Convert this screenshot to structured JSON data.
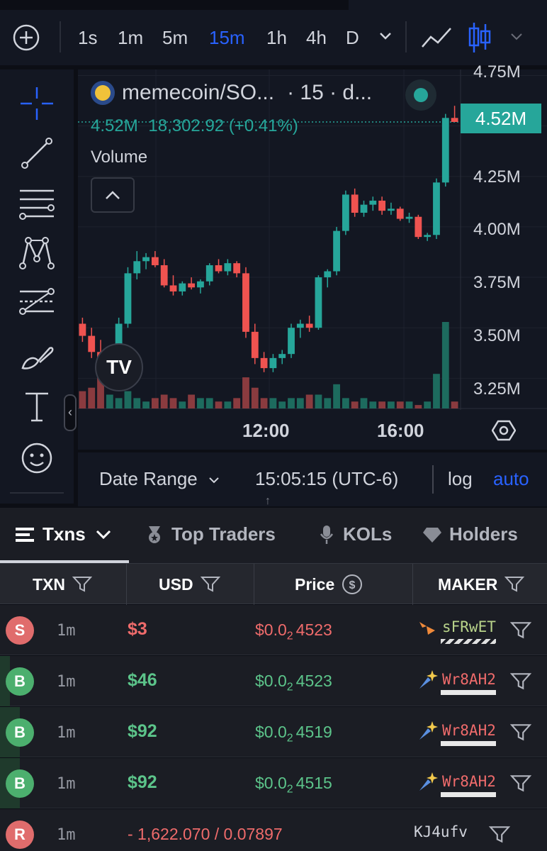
{
  "toolbar": {
    "intervals": [
      "1s",
      "1m",
      "5m",
      "15m",
      "1h",
      "4h",
      "D"
    ],
    "active_interval": "15m"
  },
  "chart_header": {
    "symbol": "memecoin/SO...",
    "meta": "· 15 · d...",
    "last": "4.52M",
    "change": "18,302.92 (+0.41%)",
    "volume_label": "Volume",
    "price_tag": "4.52M"
  },
  "price_axis": [
    "4.75M",
    "4.25M",
    "4.00M",
    "3.75M",
    "3.50M",
    "3.25M"
  ],
  "time_axis": [
    "12:00",
    "16:00"
  ],
  "range_bar": {
    "date_range": "Date Range",
    "time": "15:05:15 (UTC-6)",
    "log": "log",
    "auto": "auto"
  },
  "tabs": [
    {
      "label": "Txns",
      "icon": "list-icon"
    },
    {
      "label": "Top Traders",
      "icon": "medal-icon"
    },
    {
      "label": "KOLs",
      "icon": "microphone-icon"
    },
    {
      "label": "Holders",
      "icon": "diamond-icon"
    }
  ],
  "table_headers": {
    "txn": "TXN",
    "usd": "USD",
    "price": "Price",
    "maker": "MAKER"
  },
  "rows": [
    {
      "type": "S",
      "age": "1m",
      "usd": "$3",
      "price_pre": "$0.0",
      "price_sub": "2",
      "price_post": "4523",
      "maker": "sFRwET",
      "side": "sell"
    },
    {
      "type": "B",
      "age": "1m",
      "usd": "$46",
      "price_pre": "$0.0",
      "price_sub": "2",
      "price_post": "4523",
      "maker": "Wr8AH2",
      "side": "buy"
    },
    {
      "type": "B",
      "age": "1m",
      "usd": "$92",
      "price_pre": "$0.0",
      "price_sub": "2",
      "price_post": "4519",
      "maker": "Wr8AH2",
      "side": "buy"
    },
    {
      "type": "B",
      "age": "1m",
      "usd": "$92",
      "price_pre": "$0.0",
      "price_sub": "2",
      "price_post": "4515",
      "maker": "Wr8AH2",
      "side": "buy"
    },
    {
      "type": "R",
      "age": "1m",
      "usd": "- 1,622.070 / 0.07897",
      "maker": "KJ4ufv",
      "side": "remove"
    }
  ],
  "colors": {
    "up": "#26a69a",
    "down": "#ef5350",
    "accent": "#2962ff"
  },
  "chart_data": {
    "type": "candlestick",
    "y_unit": "M",
    "ylim": [
      3.1,
      4.78
    ],
    "x_ticks": [
      "12:00",
      "16:00"
    ],
    "candles": [
      [
        3.52,
        3.55,
        3.43,
        3.46
      ],
      [
        3.46,
        3.5,
        3.35,
        3.38
      ],
      [
        3.38,
        3.44,
        3.28,
        3.3
      ],
      [
        3.3,
        3.38,
        3.25,
        3.36
      ],
      [
        3.36,
        3.55,
        3.34,
        3.52
      ],
      [
        3.52,
        3.8,
        3.5,
        3.77
      ],
      [
        3.77,
        3.88,
        3.74,
        3.83
      ],
      [
        3.83,
        3.87,
        3.79,
        3.85
      ],
      [
        3.85,
        3.88,
        3.8,
        3.81
      ],
      [
        3.81,
        3.84,
        3.7,
        3.71
      ],
      [
        3.71,
        3.76,
        3.66,
        3.68
      ],
      [
        3.68,
        3.73,
        3.66,
        3.72
      ],
      [
        3.72,
        3.75,
        3.69,
        3.7
      ],
      [
        3.7,
        3.74,
        3.67,
        3.73
      ],
      [
        3.73,
        3.82,
        3.71,
        3.81
      ],
      [
        3.81,
        3.84,
        3.77,
        3.78
      ],
      [
        3.78,
        3.84,
        3.76,
        3.82
      ],
      [
        3.82,
        3.83,
        3.75,
        3.77
      ],
      [
        3.77,
        3.8,
        3.45,
        3.48
      ],
      [
        3.48,
        3.52,
        3.32,
        3.35
      ],
      [
        3.35,
        3.38,
        3.28,
        3.3
      ],
      [
        3.3,
        3.37,
        3.28,
        3.35
      ],
      [
        3.35,
        3.39,
        3.32,
        3.37
      ],
      [
        3.37,
        3.52,
        3.35,
        3.5
      ],
      [
        3.5,
        3.54,
        3.45,
        3.52
      ],
      [
        3.52,
        3.56,
        3.48,
        3.5
      ],
      [
        3.5,
        3.76,
        3.49,
        3.75
      ],
      [
        3.75,
        3.79,
        3.7,
        3.78
      ],
      [
        3.78,
        4.0,
        3.76,
        3.98
      ],
      [
        3.98,
        4.18,
        3.96,
        4.16
      ],
      [
        4.16,
        4.19,
        4.05,
        4.07
      ],
      [
        4.07,
        4.13,
        4.05,
        4.11
      ],
      [
        4.11,
        4.15,
        4.08,
        4.13
      ],
      [
        4.13,
        4.15,
        4.06,
        4.08
      ],
      [
        4.08,
        4.12,
        4.06,
        4.09
      ],
      [
        4.09,
        4.1,
        4.03,
        4.04
      ],
      [
        4.04,
        4.07,
        4.02,
        4.05
      ],
      [
        4.05,
        4.06,
        3.94,
        3.95
      ],
      [
        3.95,
        3.97,
        3.93,
        3.96
      ],
      [
        3.96,
        4.24,
        3.94,
        4.22
      ],
      [
        4.22,
        4.56,
        4.2,
        4.54
      ],
      [
        4.54,
        4.6,
        4.52,
        4.52
      ]
    ],
    "volume": [
      5,
      6,
      9,
      4,
      3,
      5,
      3,
      2,
      3,
      4,
      3,
      2,
      4,
      3,
      3,
      2,
      2,
      3,
      9,
      6,
      3,
      3,
      2,
      3,
      3,
      4,
      4,
      3,
      7,
      3,
      2,
      3,
      2,
      2,
      2,
      2,
      2,
      1,
      2,
      10,
      25,
      2
    ]
  }
}
